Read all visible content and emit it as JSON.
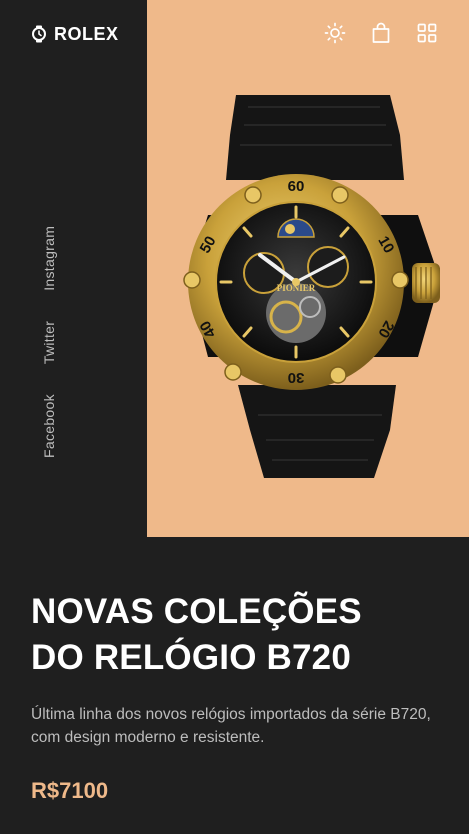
{
  "header": {
    "brand": "ROLEX",
    "icons": [
      "watch-icon",
      "sun-icon",
      "shopping-bag-icon",
      "grid-icon"
    ]
  },
  "social": {
    "links": [
      "Facebook",
      "Twitter",
      "Instagram"
    ]
  },
  "hero": {
    "title_line_1": "NOVAS COLEÇÕES",
    "title_line_2": "DO RELÓGIO B720",
    "description": "Última linha dos novos relógios importados da série B720, com design moderno e resistente.",
    "price": "R$7100",
    "watch_dial_brand": "PIONIER",
    "bezel_numbers": [
      "60",
      "10",
      "20",
      "30",
      "40",
      "50"
    ]
  },
  "colors": {
    "background": "#1f1f1f",
    "accent": "#efb98a",
    "text_primary": "#ffffff",
    "text_secondary": "#bdbdbd",
    "gold": "#c9a640"
  }
}
